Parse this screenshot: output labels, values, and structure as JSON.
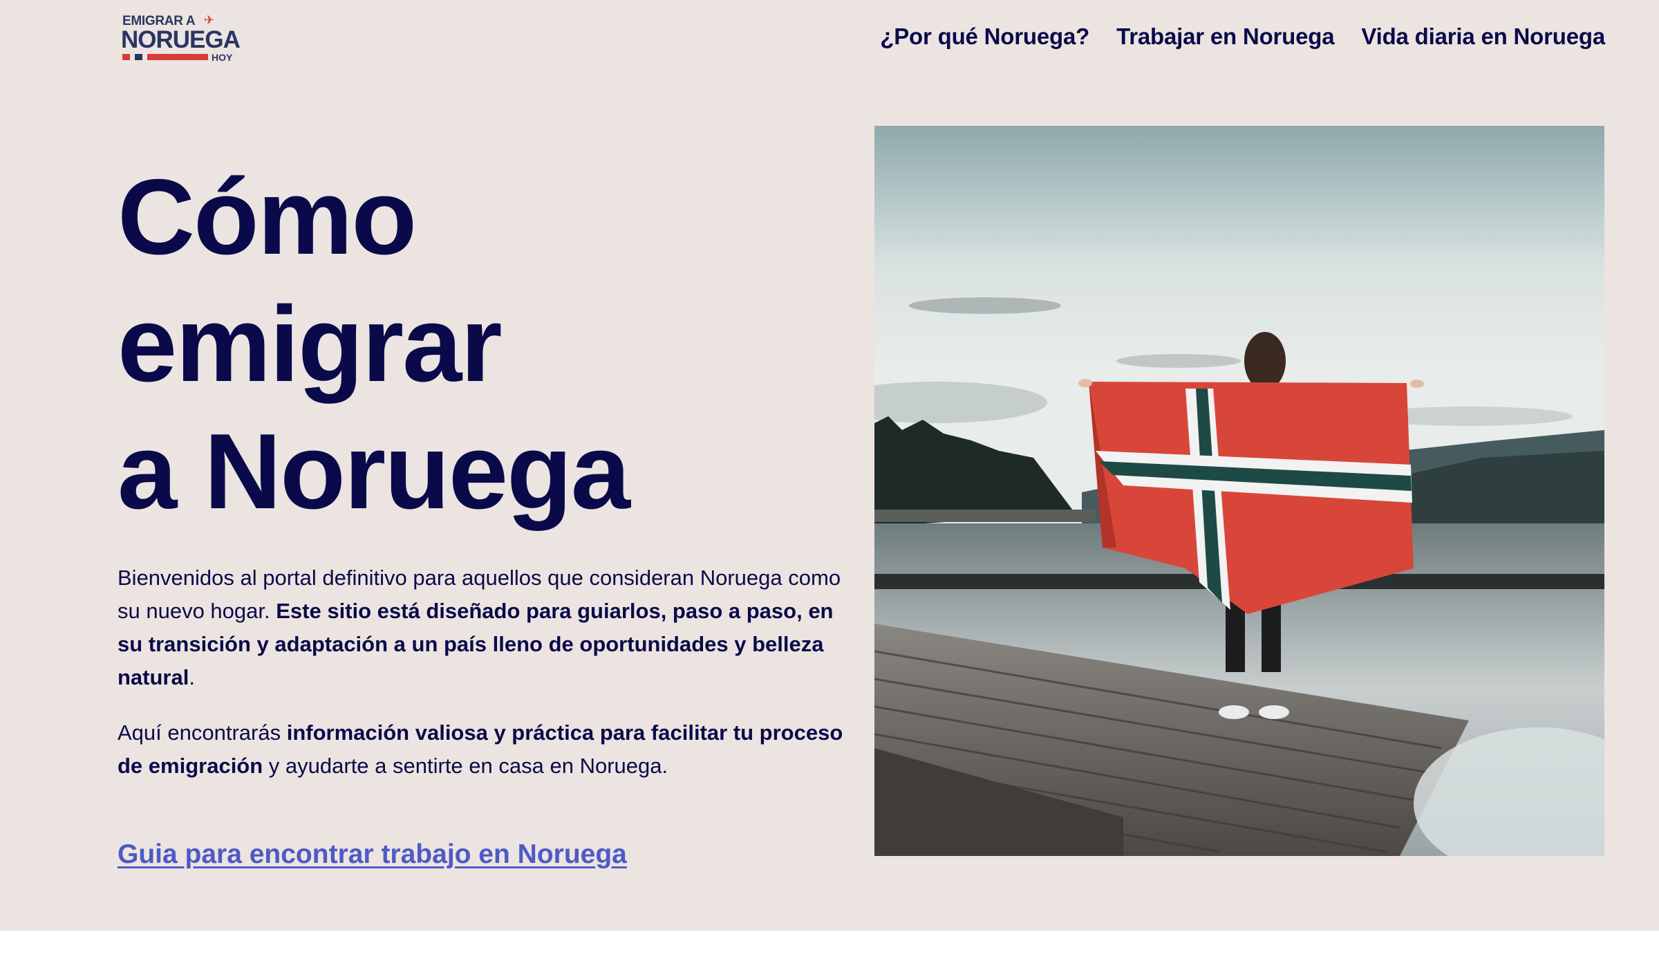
{
  "logo": {
    "line1": "EMIGRAR A",
    "line2": "NORUEGA",
    "line3": "HOY",
    "icon": "airplane-icon",
    "colors": {
      "navy": "#2a3563",
      "red": "#d83a3a"
    }
  },
  "nav": {
    "items": [
      {
        "label": "¿Por qué Noruega?"
      },
      {
        "label": "Trabajar en Noruega"
      },
      {
        "label": "Vida diaria en Noruega"
      }
    ]
  },
  "hero": {
    "title_lines": [
      "Cómo",
      "emigrar",
      "a Noruega"
    ],
    "intro": {
      "p1_a": "Bienvenidos al portal definitivo para aquellos que consideran Noruega como su nuevo hogar. ",
      "p1_b": "Este sitio está diseñado para guiarlos, paso a paso, en su transición y adaptación a un país lleno de oportunidades y belleza natural",
      "p1_c": ".",
      "p2_a": "Aquí encontrarás ",
      "p2_b": "información valiosa y práctica para facilitar tu proceso de emigración",
      "p2_c": " y ayudarte a sentirte en casa en Noruega."
    },
    "cta_label": "Guia para encontrar trabajo en Noruega",
    "image_subject": "woman holding Norwegian flag on a wooden pier by a fjord"
  },
  "colors": {
    "background": "#ece4e0",
    "text": "#0a0a4a",
    "link": "#4d5ac6"
  }
}
